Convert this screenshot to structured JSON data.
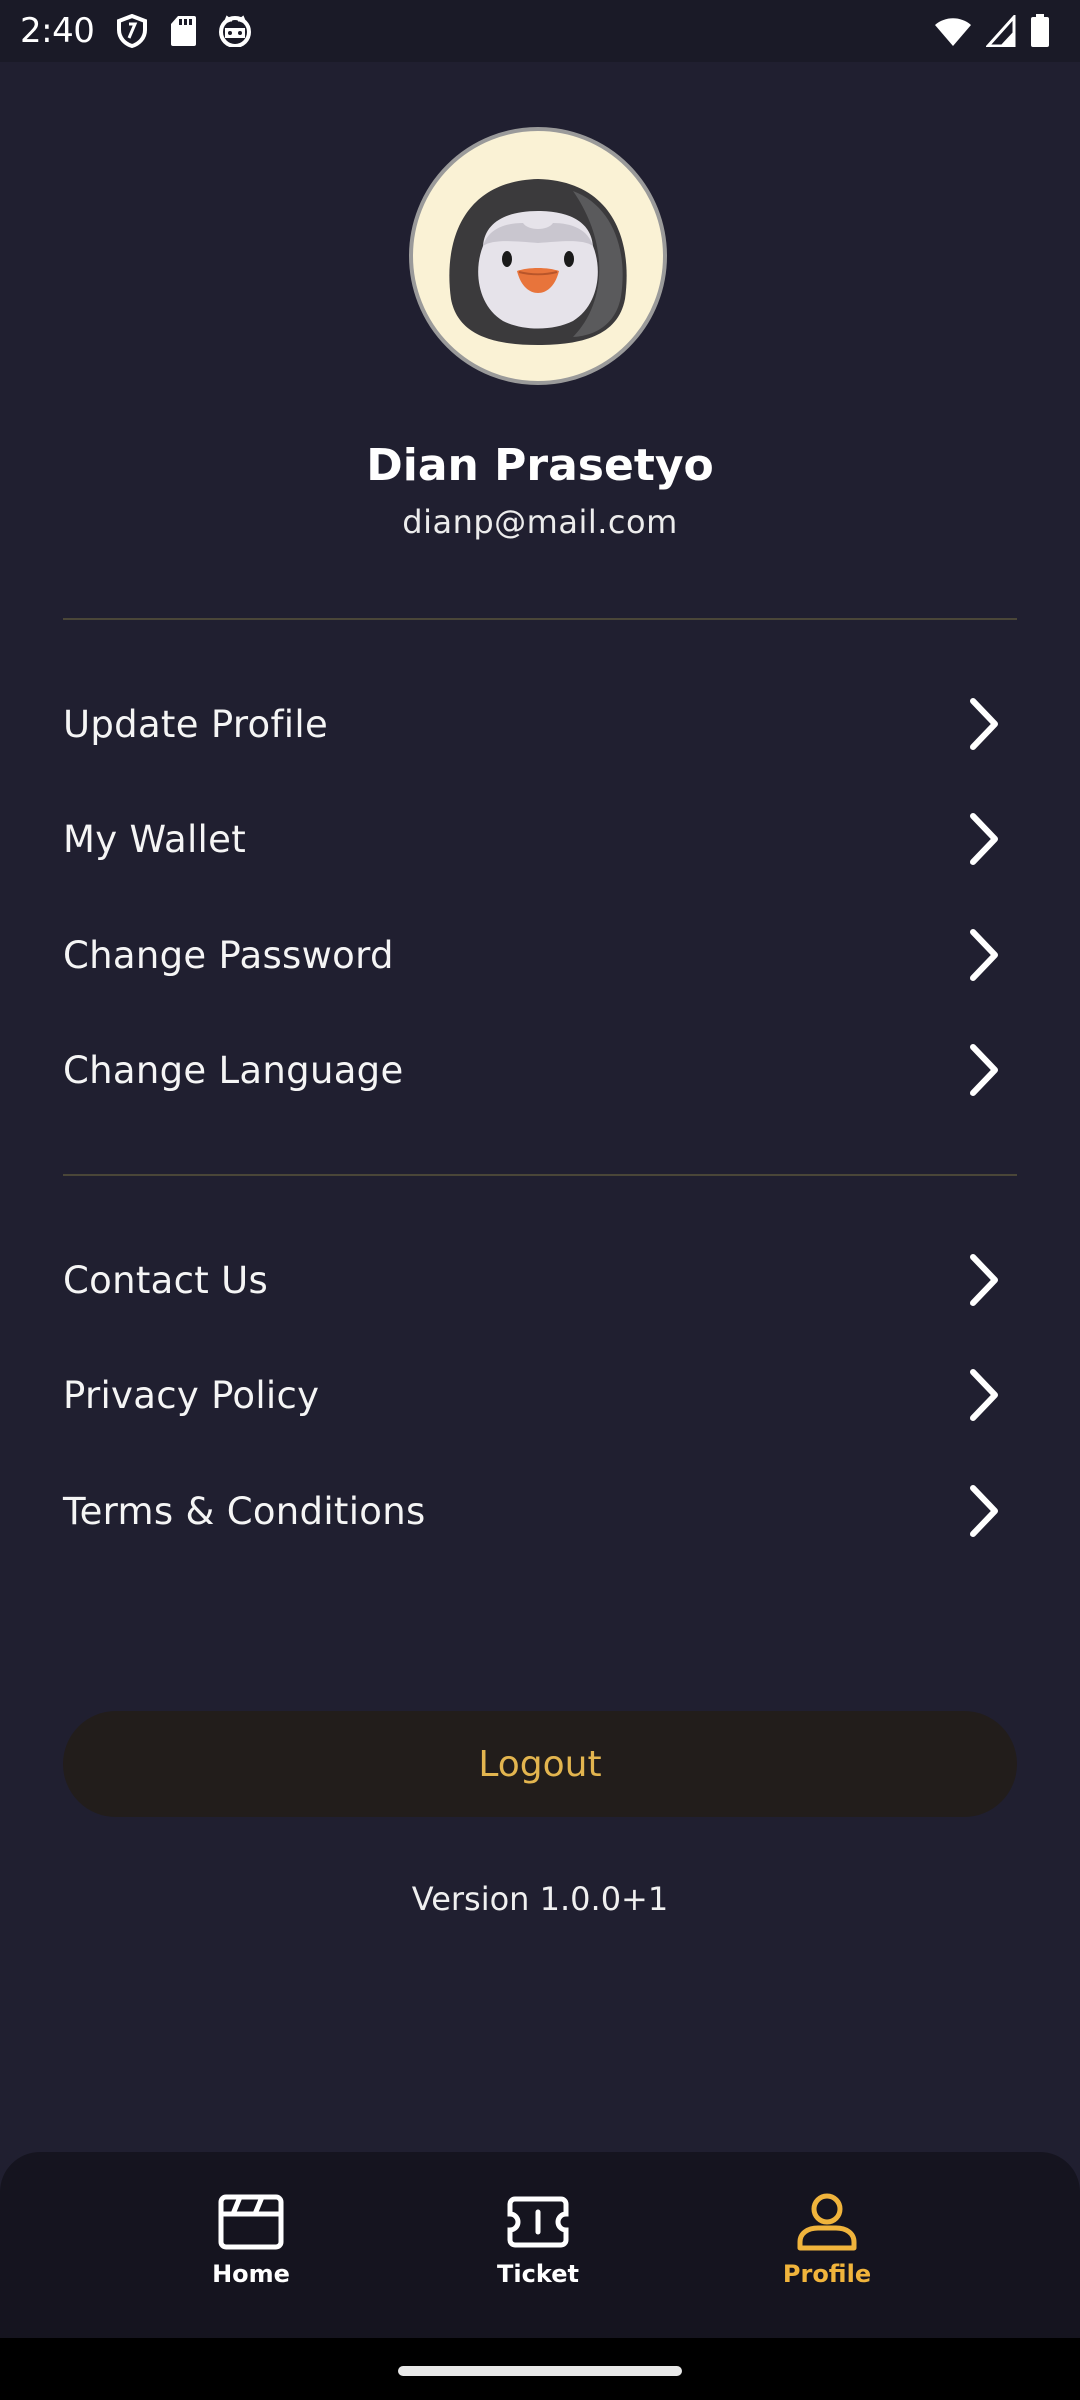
{
  "status_bar": {
    "time": "2:40",
    "icons": [
      "shield-icon",
      "sd-card-icon",
      "cat-face-icon",
      "wifi-icon",
      "signal-icon",
      "battery-icon"
    ]
  },
  "profile": {
    "name": "Dian Prasetyo",
    "email": "dianp@mail.com",
    "avatar": "penguin-avatar"
  },
  "menu_account": [
    {
      "label": "Update Profile"
    },
    {
      "label": "My Wallet"
    },
    {
      "label": "Change Password"
    },
    {
      "label": "Change Language"
    }
  ],
  "menu_info": [
    {
      "label": "Contact Us"
    },
    {
      "label": "Privacy Policy"
    },
    {
      "label": "Terms & Conditions"
    }
  ],
  "logout_label": "Logout",
  "version": "Version 1.0.0+1",
  "bottom_nav": [
    {
      "label": "Home",
      "icon": "clapperboard-icon",
      "active": false
    },
    {
      "label": "Ticket",
      "icon": "ticket-icon",
      "active": false
    },
    {
      "label": "Profile",
      "icon": "person-icon",
      "active": true
    }
  ],
  "colors": {
    "background": "#201f30",
    "accent": "#f0b43c",
    "logout_text": "#e3b54f",
    "logout_bg": "#221d1b",
    "nav_bg": "#15141f",
    "divider": "#4a4638"
  }
}
